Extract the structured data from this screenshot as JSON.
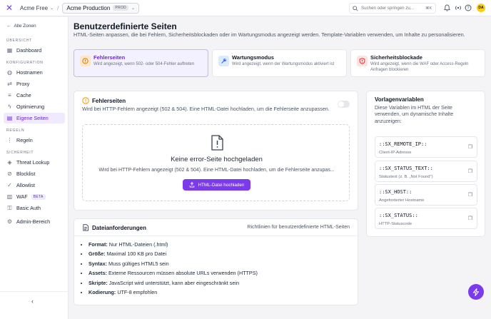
{
  "topbar": {
    "org": "Acme Free",
    "project": "Acme Production",
    "project_badge": "PROD",
    "search_placeholder": "Suchen oder springen zu...",
    "search_shortcut": "⌘K",
    "avatar": "DA"
  },
  "sidebar": {
    "back": "Alle Zonen",
    "sections": {
      "overview": "ÜBERSICHT",
      "config": "KONFIGURATION",
      "rules": "REGELN",
      "security": "SICHERHEIT"
    },
    "items": {
      "dashboard": "Dashboard",
      "hostnames": "Hostnamen",
      "proxy": "Proxy",
      "cache": "Cache",
      "optimization": "Optimierung",
      "custom_pages": "Eigene Seiten",
      "rules": "Regeln",
      "threat_lookup": "Threat Lookup",
      "blocklist": "Blocklist",
      "allowlist": "Allowlist",
      "waf": "WAF",
      "waf_badge": "BETA",
      "basic_auth": "Basic Auth",
      "admin_area": "Admin-Bereich"
    }
  },
  "page": {
    "title": "Benutzerdefinierte Seiten",
    "subtitle": "HTML-Seiten anpassen, die bei Fehlern, Sicherheitsblockaden oder im Wartungsmodus angezeigt werden. Template-Variablen verwenden, um Inhalte zu personalisieren."
  },
  "type_cards": [
    {
      "title": "Fehlerseiten",
      "desc": "Wird angezeigt, wenn 502- oder 504-Fehler auftreten"
    },
    {
      "title": "Wartungsmodus",
      "desc": "Wird angezeigt, wenn der Wartungsmodus aktiviert ist"
    },
    {
      "title": "Sicherheitsblockade",
      "desc": "Wird angezeigt, wenn die WAF oder Access-Regeln Anfragen blockieren"
    }
  ],
  "error_panel": {
    "title": "Fehlerseiten",
    "subtitle": "Wird bei HTTP-Fehlern angezeigt (502 & 504). Eine HTML-Datei hochladen, um die Fehlerseite anzupassen.",
    "empty_title": "Keine error-Seite hochgeladen",
    "empty_sub": "Wird bei HTTP-Fehlern angezeigt (502 & 504). Eine HTML-Datei hochladen, um die Fehlerseite anzupas...",
    "upload_label": "HTML-Datei hochladen"
  },
  "requirements": {
    "title": "Dateianforderungen",
    "right": "Richtlinien für benutzerdefinierte HTML-Seiten",
    "items": [
      {
        "key": "Format:",
        "val": "Nur HTML-Dateien (.html)"
      },
      {
        "key": "Größe:",
        "val": "Maximal 100 KB pro Datei"
      },
      {
        "key": "Syntax:",
        "val": "Muss gültiges HTML5 sein"
      },
      {
        "key": "Assets:",
        "val": "Externe Ressourcen müssen absolute URLs verwenden (HTTPS)"
      },
      {
        "key": "Skripte:",
        "val": "JavaScript wird unterstützt, kann aber eingeschränkt sein"
      },
      {
        "key": "Kodierung:",
        "val": "UTF-8 empfohlen"
      }
    ]
  },
  "variables": {
    "title": "Vorlagenvariablen",
    "desc": "Diese Variablen im HTML der Seite verwenden, um dynamische Inhalte anzuzeigen:",
    "items": [
      {
        "name": "::SX_REMOTE_IP::",
        "desc": "Client-IP-Adresse"
      },
      {
        "name": "::SX_STATUS_TEXT::",
        "desc": "Statustext (z. B. „Not Found\")"
      },
      {
        "name": "::SX_HOST::",
        "desc": "Angeforderter Hostname"
      },
      {
        "name": "::SX_STATUS::",
        "desc": "HTTP-Statuscode"
      }
    ]
  },
  "colors": {
    "accent": "#7c3aed",
    "accent_soft": "#efeaff",
    "error": "#f59e0b",
    "maintenance": "#2563eb",
    "security": "#dc2626"
  }
}
